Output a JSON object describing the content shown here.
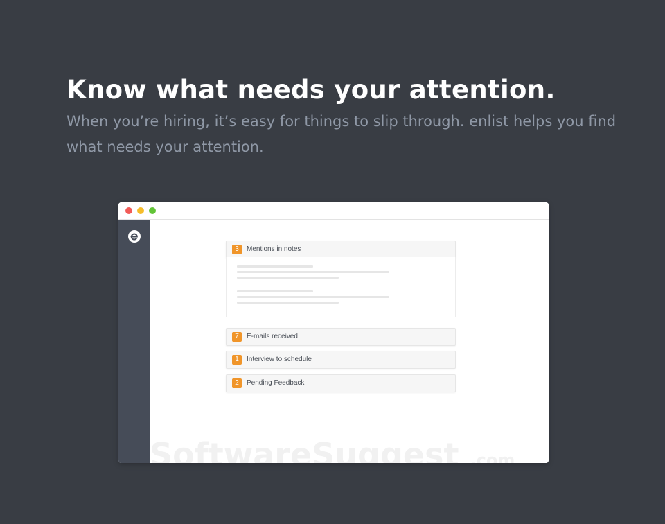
{
  "hero": {
    "title": "Know what needs your attention.",
    "subtitle": "When you’re hiring, it’s easy for things to slip through. enlist helps you find what needs your attention."
  },
  "app": {
    "logo_icon": "enlist-logo-icon",
    "panels": [
      {
        "count": "3",
        "label": "Mentions in notes",
        "expanded": true
      },
      {
        "count": "7",
        "label": "E-mails received"
      },
      {
        "count": "1",
        "label": "Interview to schedule"
      },
      {
        "count": "2",
        "label": "Pending Feedback"
      }
    ]
  },
  "watermark": {
    "text": "SoftwareSuggest",
    "suffix": ".com"
  },
  "colors": {
    "background": "#393d44",
    "sidebar": "#464c58",
    "badge": "#f0952a",
    "subtitle": "#8f98a6"
  }
}
